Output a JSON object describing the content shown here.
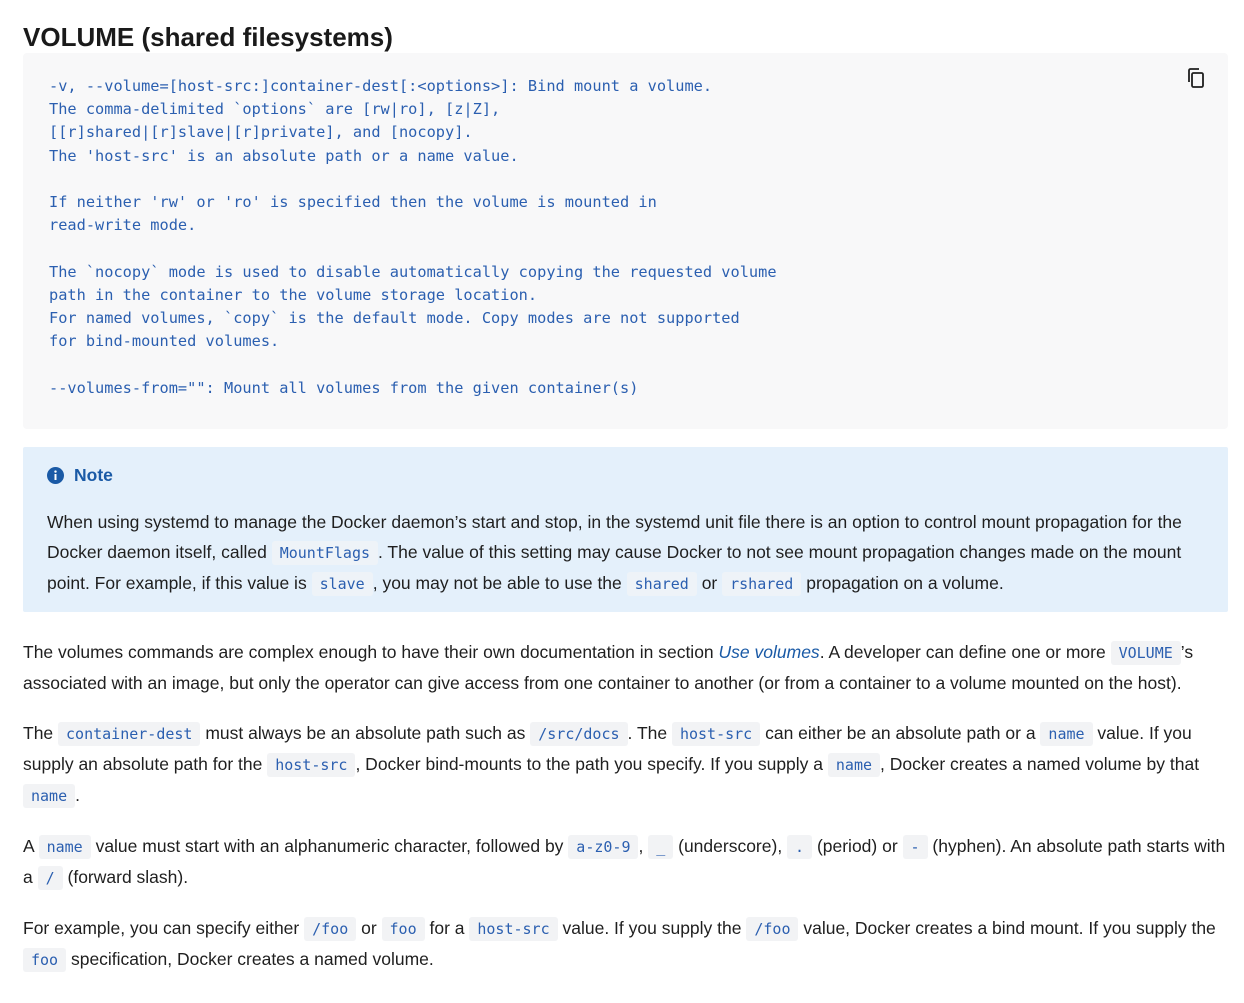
{
  "heading": "VOLUME (shared filesystems)",
  "code_block": {
    "text": "-v, --volume=[host-src:]container-dest[:<options>]: Bind mount a volume.\nThe comma-delimited `options` are [rw|ro], [z|Z],\n[[r]shared|[r]slave|[r]private], and [nocopy].\nThe 'host-src' is an absolute path or a name value.\n\nIf neither 'rw' or 'ro' is specified then the volume is mounted in\nread-write mode.\n\nThe `nocopy` mode is used to disable automatically copying the requested volume\npath in the container to the volume storage location.\nFor named volumes, `copy` is the default mode. Copy modes are not supported\nfor bind-mounted volumes.\n\n--volumes-from=\"\": Mount all volumes from the given container(s)",
    "copy_icon": "copy-icon"
  },
  "note": {
    "icon": "info-icon",
    "title": "Note",
    "t1": "When using systemd to manage the Docker daemon’s start and stop, in the systemd unit file there is an option to control mount propagation for the Docker daemon itself, called ",
    "c1": "MountFlags",
    "t2": ". The value of this setting may cause Docker to not see mount propagation changes made on the mount point. For example, if this value is ",
    "c2": "slave",
    "t3": ", you may not be able to use the ",
    "c3": "shared",
    "t4": " or ",
    "c4": "rshared",
    "t5": " propagation on a volume."
  },
  "p1": {
    "t1": "The volumes commands are complex enough to have their own documentation in section ",
    "link": "Use volumes",
    "t2": ". A developer can define one or more ",
    "c1": "VOLUME",
    "t3": "’s associated with an image, but only the operator can give access from one container to another (or from a container to a volume mounted on the host)."
  },
  "p2": {
    "t1": "The ",
    "c1": "container-dest",
    "t2": " must always be an absolute path such as ",
    "c2": "/src/docs",
    "t3": ". The ",
    "c3": "host-src",
    "t4": " can either be an absolute path or a ",
    "c4": "name",
    "t5": " value. If you supply an absolute path for the ",
    "c5": "host-src",
    "t6": ", Docker bind-mounts to the path you specify. If you supply a ",
    "c6": "name",
    "t7": ", Docker creates a named volume by that ",
    "c7": "name",
    "t8": "."
  },
  "p3": {
    "t1": "A ",
    "c1": "name",
    "t2": " value must start with an alphanumeric character, followed by ",
    "c2": "a-z0-9",
    "t3": ", ",
    "c3": "_",
    "t4": " (underscore), ",
    "c4": ".",
    "t5": " (period) or ",
    "c5": "-",
    "t6": " (hyphen). An absolute path starts with a ",
    "c6": "/",
    "t7": " (forward slash)."
  },
  "p4": {
    "t1": "For example, you can specify either ",
    "c1": "/foo",
    "t2": " or ",
    "c2": "foo",
    "t3": " for a ",
    "c3": "host-src",
    "t4": " value. If you supply the ",
    "c4": "/foo",
    "t5": " value, Docker creates a bind mount. If you supply the ",
    "c5": "foo",
    "t6": " specification, Docker creates a named volume."
  }
}
